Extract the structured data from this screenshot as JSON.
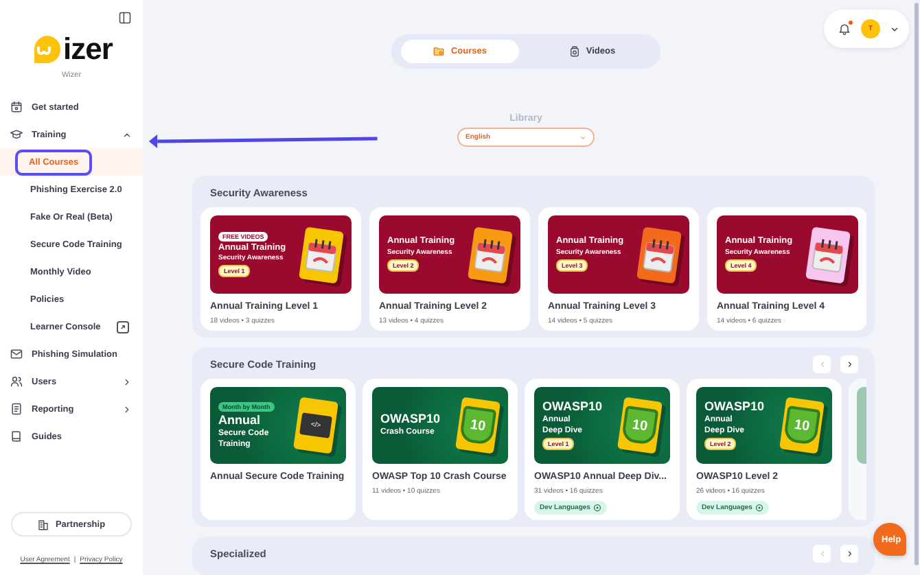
{
  "sidebar": {
    "logo_text": "izer",
    "org_name": "Wizer",
    "items": [
      {
        "label": "Get started",
        "selected": false
      },
      {
        "label": "Training",
        "selected": false,
        "expanded": true,
        "children": [
          {
            "label": "All Courses",
            "selected": true,
            "annotated": true,
            "external": false
          },
          {
            "label": "Phishing Exercise 2.0",
            "selected": false,
            "annotated": false,
            "external": false
          },
          {
            "label": "Fake Or Real (Beta)",
            "selected": false,
            "annotated": false,
            "external": false
          },
          {
            "label": "Secure Code Training",
            "selected": false,
            "annotated": false,
            "external": false
          },
          {
            "label": "Monthly Video",
            "selected": false,
            "annotated": false,
            "external": false
          },
          {
            "label": "Policies",
            "selected": false,
            "annotated": false,
            "external": false
          },
          {
            "label": "Learner Console",
            "selected": false,
            "annotated": false,
            "external": true
          }
        ]
      },
      {
        "label": "Phishing Simulation",
        "selected": false
      },
      {
        "label": "Users",
        "selected": false,
        "expanded": false
      },
      {
        "label": "Reporting",
        "selected": false,
        "expanded": false
      },
      {
        "label": "Guides",
        "selected": false
      }
    ],
    "partnership_button": "Partnership",
    "footer_links": [
      "User Agreement",
      "Privacy Policy"
    ],
    "footer_separator": "|"
  },
  "view_tabs": [
    {
      "label": "Courses",
      "selected": true
    },
    {
      "label": "Videos",
      "selected": false
    }
  ],
  "header": {
    "notifications_unread": true,
    "avatar_initial": "T"
  },
  "library": {
    "label": "Library",
    "language": "English"
  },
  "sections": [
    {
      "title": "Security Awareness",
      "kind": "awareness",
      "cards": [
        {
          "title": "Annual Training Level 1",
          "meta": "18 videos • 3 quizzes",
          "thumb": {
            "badge": "FREE VIDEOS",
            "lines": [
              "Annual Training",
              "Security Awareness"
            ],
            "level": "Level 1",
            "color": "#f7c600",
            "kind": "calendar"
          }
        },
        {
          "title": "Annual Training Level 2",
          "meta": "13 videos • 4 quizzes",
          "thumb": {
            "lines": [
              "Annual Training",
              "Security Awareness"
            ],
            "level": "Level 2",
            "color": "#f79a12",
            "kind": "calendar"
          }
        },
        {
          "title": "Annual Training Level 3",
          "meta": "14 videos • 5 quizzes",
          "thumb": {
            "lines": [
              "Annual Training",
              "Security Awareness"
            ],
            "level": "Level 3",
            "color": "#f26a1b",
            "kind": "calendar"
          }
        },
        {
          "title": "Annual Training Level 4",
          "meta": "14 videos • 6 quizzes",
          "thumb": {
            "lines": [
              "Annual Training",
              "Security Awareness"
            ],
            "level": "Level 4",
            "color": "#f6c6ef",
            "kind": "calendar"
          }
        }
      ]
    },
    {
      "title": "Secure Code Training",
      "kind": "code",
      "more_cards": true,
      "nav": [
        {
          "disabled": true
        },
        {
          "disabled": false
        }
      ],
      "cards": [
        {
          "title": "Annual Secure Code Training",
          "thumb": {
            "badge": "Month by Month",
            "lines": [
              "Annual",
              "Secure Code",
              "Training"
            ],
            "color": "#f7c600",
            "kind": "code",
            "tile_text": "</>"
          }
        },
        {
          "title": "OWASP Top 10 Crash Course",
          "meta": "11 videos • 10 quizzes",
          "thumb": {
            "lines": [
              "OWASP10",
              "Crash Course"
            ],
            "color": "#f7c600",
            "kind": "shield",
            "tile_text": "10"
          }
        },
        {
          "title": "OWASP10 Annual Deep Div...",
          "meta": "31 videos • 16 quizzes",
          "tag": "Dev Languages",
          "thumb": {
            "lines": [
              "OWASP10",
              "Annual",
              "Deep Dive"
            ],
            "level": "Level 1",
            "color": "#f7c600",
            "kind": "shield",
            "tile_text": "10"
          }
        },
        {
          "title": "OWASP10 Level 2",
          "meta": "26 videos • 16 quizzes",
          "tag": "Dev Languages",
          "thumb": {
            "lines": [
              "OWASP10",
              "Annual",
              "Deep Dive"
            ],
            "level": "Level 2",
            "color": "#f7c600",
            "kind": "shield",
            "tile_text": "10"
          }
        }
      ]
    },
    {
      "title": "Specialized",
      "nav": [
        {
          "disabled": true
        },
        {
          "disabled": false
        }
      ]
    }
  ],
  "help_button": "Help"
}
